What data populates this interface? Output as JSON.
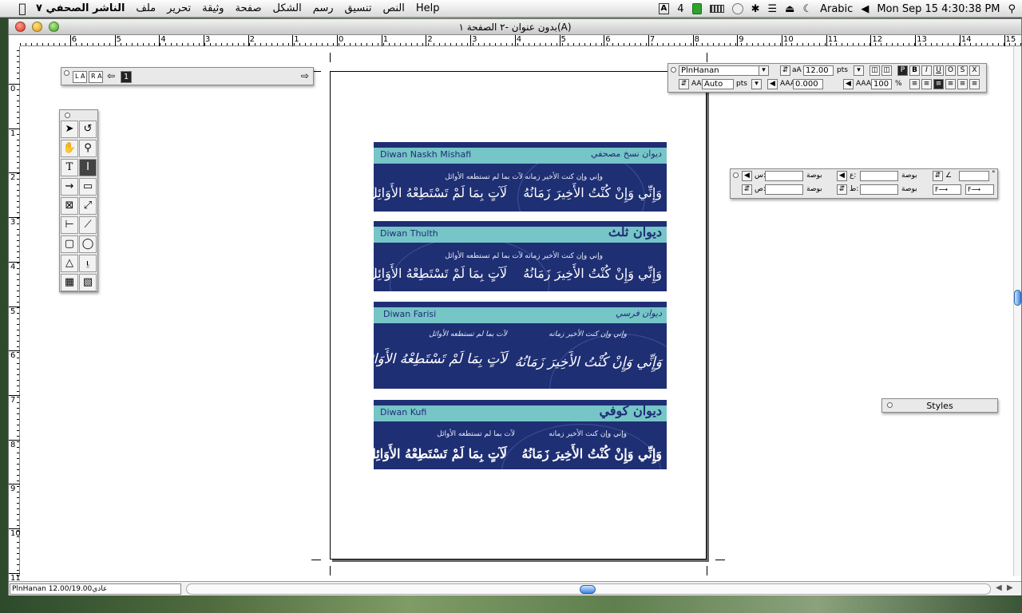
{
  "menubar": {
    "app_name": "الناشر الصحفي ٧",
    "items": [
      "ملف",
      "تحرير",
      "وثيقة",
      "صفحة",
      "الشكل",
      "رسم",
      "تنسيق",
      "النص",
      "Help"
    ],
    "status": {
      "input_badge": "4",
      "language": "Arabic",
      "datetime": "Mon Sep 15  4:30:38 PM"
    }
  },
  "window": {
    "title": "بدون عنوان -٢ الصفحة ١(A)"
  },
  "rulers": {
    "horizontal_ticks": [
      "6",
      "5",
      "4",
      "3",
      "2",
      "1",
      "0",
      "1",
      "2",
      "3",
      "4",
      "5",
      "6",
      "7",
      "8",
      "9",
      "10",
      "11",
      "12",
      "13",
      "14",
      "15"
    ],
    "vertical_ticks": [
      "0",
      "1",
      "2",
      "3",
      "4",
      "5",
      "6",
      "7",
      "8",
      "9",
      "10",
      "11"
    ]
  },
  "nav_palette": {
    "page_number": "1",
    "left_label": "L A",
    "right_label": "R A"
  },
  "char_palette": {
    "font_name": "PlnHanan",
    "size": "12.00",
    "size_unit": "pts",
    "leading": "Auto",
    "leading_unit": "pts",
    "tracking": "0.000",
    "scale": "100",
    "scale_unit": "%",
    "style_buttons": [
      "P",
      "B",
      "I",
      "U",
      "O",
      "S",
      "X"
    ]
  },
  "measure_palette": {
    "label_inch": "بوصة",
    "x_label": "س:",
    "y_label": "ص:",
    "w_label": "ع:",
    "h_label": "ط:",
    "degree": "°"
  },
  "styles_palette": {
    "title": "Styles"
  },
  "specimens": [
    {
      "latin": "Diwan Naskh Mishafi",
      "arabic_title": "ديوان نسخ مصحفي",
      "small_right": "وإني وإن كنت الأخير زمانه",
      "small_left": "لآت بما لم تستطعه الأوائل",
      "large_right": "وَإِنِّي وَإِنْ كُنْتُ الأَخِيرَ زَمَانُهُ",
      "large_left": "لَآتٍ بِمَا لَمْ تَسْتَطِعْهُ الأَوَائِلُ"
    },
    {
      "latin": "Diwan Thulth",
      "arabic_title": "ديوان ثلث",
      "small_right": "وإني وإن كنت الأخير زمانه",
      "small_left": "لآت بما لم تستطعه الأوائل",
      "large_right": "وَإِنِّي وَإِنْ كُنْتُ الأَخِيرَ زَمَانُهُ",
      "large_left": "لَآتٍ بِمَا لَمْ تَسْتَطِعْهُ الأَوَائِلُ"
    },
    {
      "latin": "Diwan Farisi",
      "arabic_title": "ديوان فرسي",
      "small_right": "وإني وإن كنت الأخير زمانه",
      "small_left": "لآت بما لم تستطعه الأوائل",
      "large_right": "وَإِنِّي وَإِنْ كُنْتُ الأَخِيرَ زَمَانُهُ",
      "large_left": "لَآتٍ بِمَا لَمْ تَسْتَطِعْهُ الأَوَائِلُ"
    },
    {
      "latin": "Diwan Kufi",
      "arabic_title": "ديوان كوفي",
      "small_right": "وإني وإن كنت الأخير زمانه",
      "small_left": "لآت بما لم تستطعه الأوائل",
      "large_right": "وَإِنِّي وَإِنْ كُنْتُ الأَخِيرَ زَمَانُهُ",
      "large_left": "لَآتٍ بِمَا لَمْ تَسْتَطِعْهُ الأَوَائِلُ"
    }
  ],
  "statusbar": {
    "text": "PlnHanan 12.00/19.00عادي"
  },
  "colors": {
    "banner_navy": "#1f2f74",
    "banner_teal": "#76c5c7"
  }
}
